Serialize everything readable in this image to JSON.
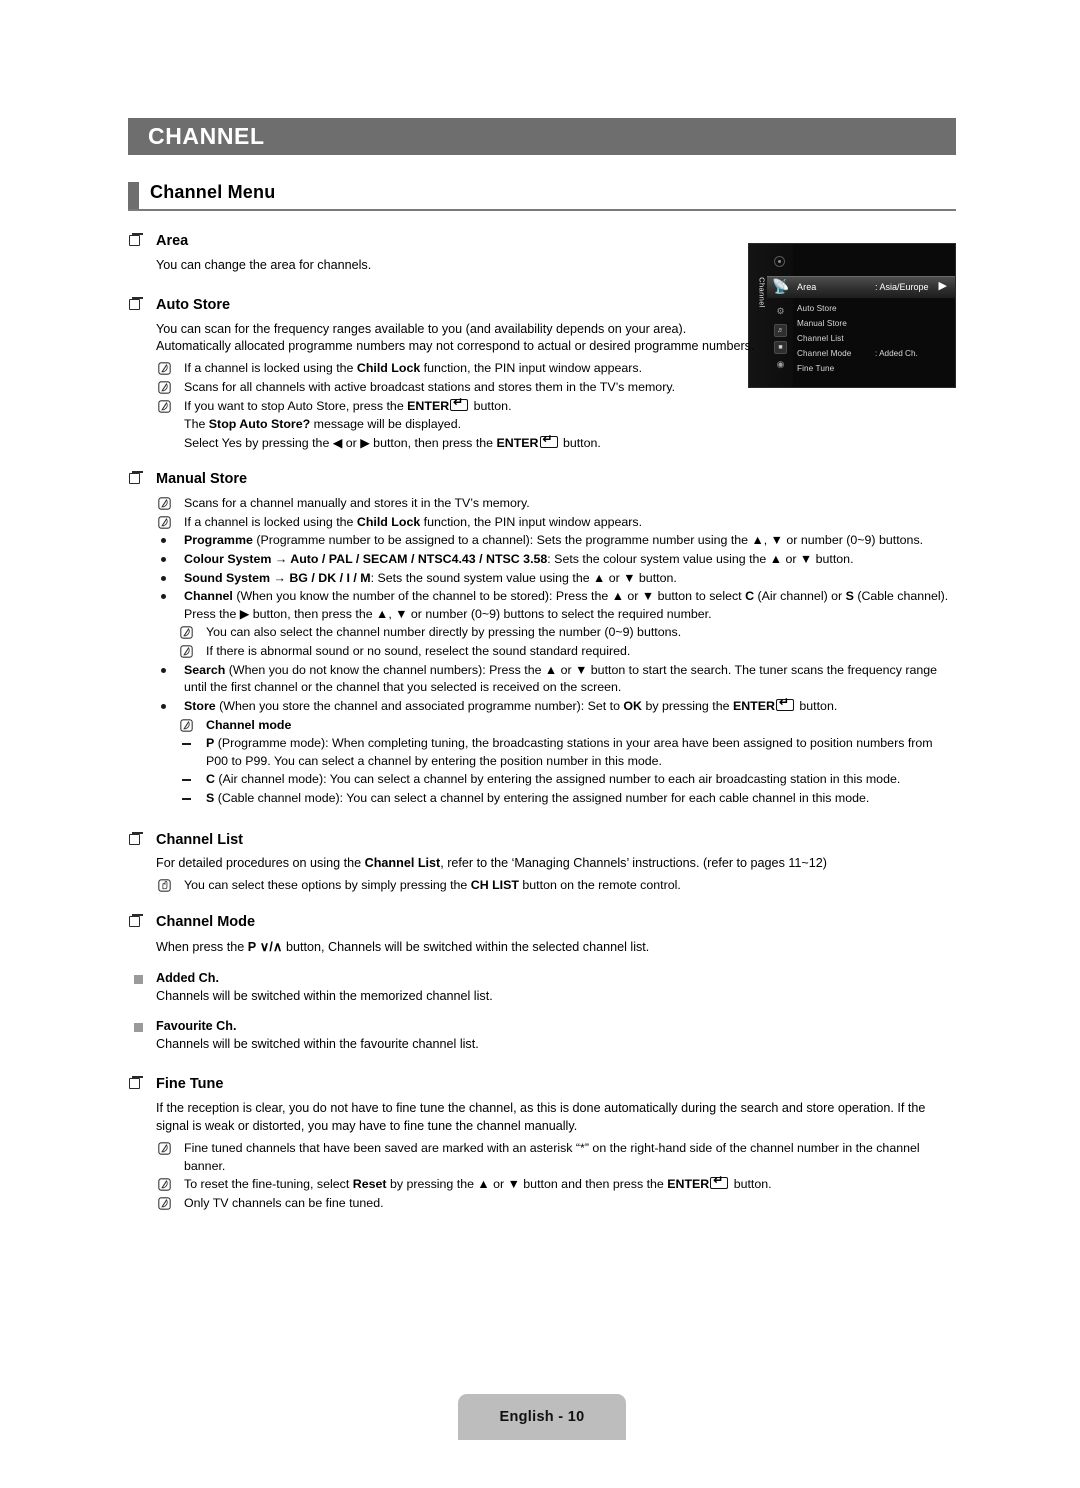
{
  "chapter": {
    "title": "CHANNEL"
  },
  "section": {
    "title": "Channel Menu"
  },
  "footer": {
    "page_label": "English - 10"
  },
  "tv_menu": {
    "sidebar_title": "Channel",
    "selected_item": "Area",
    "selected_value": ": Asia/Europe",
    "items": [
      {
        "label": "Auto Store",
        "value": ""
      },
      {
        "label": "Manual Store",
        "value": ""
      },
      {
        "label": "Channel List",
        "value": ""
      },
      {
        "label": "Channel Mode",
        "value": ": Added Ch."
      },
      {
        "label": "Fine Tune",
        "value": ""
      }
    ]
  },
  "area": {
    "heading": "Area",
    "body": "You can change the area for channels."
  },
  "auto_store": {
    "heading": "Auto Store",
    "body": "You can scan for the frequency ranges available to you (and availability depends on your area). Automatically allocated programme numbers may not correspond to actual or desired programme numbers.",
    "note1_a": "If a channel is locked using the ",
    "note1_b": "Child Lock",
    "note1_c": " function, the PIN input window appears.",
    "note2": "Scans for all channels with active broadcast stations and stores them in the TV’s memory.",
    "note3_a": "If you want to stop Auto Store, press the ",
    "note3_b": "ENTER",
    "note3_c": " button.",
    "note3_sub1_a": "The ",
    "note3_sub1_b": "Stop Auto Store?",
    "note3_sub1_c": " message will be displayed.",
    "note3_sub2_a": "Select Yes by pressing the ◀ or ▶ button, then press the ",
    "note3_sub2_b": "ENTER",
    "note3_sub2_c": " button."
  },
  "manual_store": {
    "heading": "Manual Store",
    "note1": "Scans for a channel manually and stores it in the TV’s memory.",
    "note2_a": "If a channel is locked using the ",
    "note2_b": "Child Lock",
    "note2_c": " function, the PIN input window appears.",
    "b_programme_label": "Programme",
    "b_programme_text": " (Programme number to be assigned to a channel): Sets the programme number using the ▲, ▼ or number (0~9) buttons.",
    "b_colour_label": "Colour System → Auto / PAL / SECAM / NTSC4.43 / NTSC 3.58",
    "b_colour_text": ": Sets the colour system value using the ▲ or ▼ button.",
    "b_sound_label": "Sound System → BG / DK / I / M",
    "b_sound_text": ": Sets the sound system value using the ▲ or ▼ button.",
    "b_channel_label": "Channel",
    "b_channel_text1": " (When you know the number of the channel to be stored): Press the ▲ or ▼ button to select ",
    "b_channel_c": "C",
    "b_channel_text2": " (Air channel) or ",
    "b_channel_s": "S",
    "b_channel_text3": " (Cable channel). Press the ▶ button, then press the ▲, ▼ or number (0~9) buttons to select the required number.",
    "ch_note1": "You can also select the channel number directly by pressing the number (0~9) buttons.",
    "ch_note2": "If there is abnormal sound or no sound, reselect the sound standard required.",
    "b_search_label": "Search",
    "b_search_text": " (When you do not know the channel numbers): Press the ▲ or ▼ button to start the search. The tuner scans the frequency range until the first channel or the channel that you selected is received on the screen.",
    "b_store_label": "Store",
    "b_store_text1": " (When you store the channel and associated programme number): Set to ",
    "b_store_ok": "OK",
    "b_store_text2": " by pressing the ",
    "b_store_enter": "ENTER",
    "b_store_text3": " button.",
    "channel_mode_note": "Channel mode",
    "mode_p_label": "P",
    "mode_p_text": " (Programme mode): When completing tuning, the broadcasting stations in your area have been assigned to position numbers from P00 to P99. You can select a channel by entering the position number in this mode.",
    "mode_c_label": "C",
    "mode_c_text": " (Air channel mode): You can select a channel by entering the assigned number to each air broadcasting station in this mode.",
    "mode_s_label": "S",
    "mode_s_text": " (Cable channel mode): You can select a channel by entering the assigned number for each cable channel in this mode."
  },
  "channel_list": {
    "heading": "Channel List",
    "body_a": "For detailed procedures on using the ",
    "body_b": "Channel List",
    "body_c": ", refer to the ‘Managing Channels’ instructions. (refer to pages 11~12)",
    "note_a": "You can select these options by simply pressing the ",
    "note_b": "CH LIST",
    "note_c": " button on the remote control."
  },
  "channel_mode": {
    "heading": "Channel Mode",
    "body_a": "When press the ",
    "body_p": "P",
    "body_glyph": " ∨/∧ ",
    "body_c": "button, Channels will be switched within the selected channel list.",
    "added": {
      "label": "Added Ch.",
      "body": "Channels will be switched within the memorized channel list."
    },
    "favourite": {
      "label": "Favourite Ch.",
      "body": "Channels will be switched within the favourite channel list."
    }
  },
  "fine_tune": {
    "heading": "Fine Tune",
    "body": "If the reception is clear, you do not have to fine tune the channel, as this is done automatically during the search and store operation. If the signal is weak or distorted, you may have to fine tune the channel manually.",
    "note1": "Fine tuned channels that have been saved are marked with an asterisk “*” on the right-hand side of the channel number in the channel banner.",
    "note2_a": "To reset the fine-tuning, select ",
    "note2_b": "Reset",
    "note2_c": " by pressing the ▲ or ▼ button and then press the ",
    "note2_d": "ENTER",
    "note2_e": " button.",
    "note3": "Only TV channels can be fine tuned."
  },
  "colors": {
    "banner_grey": "#6e6e6e",
    "footer_grey": "#bdbdbd",
    "bullet_grey": "#9a9a9a"
  }
}
